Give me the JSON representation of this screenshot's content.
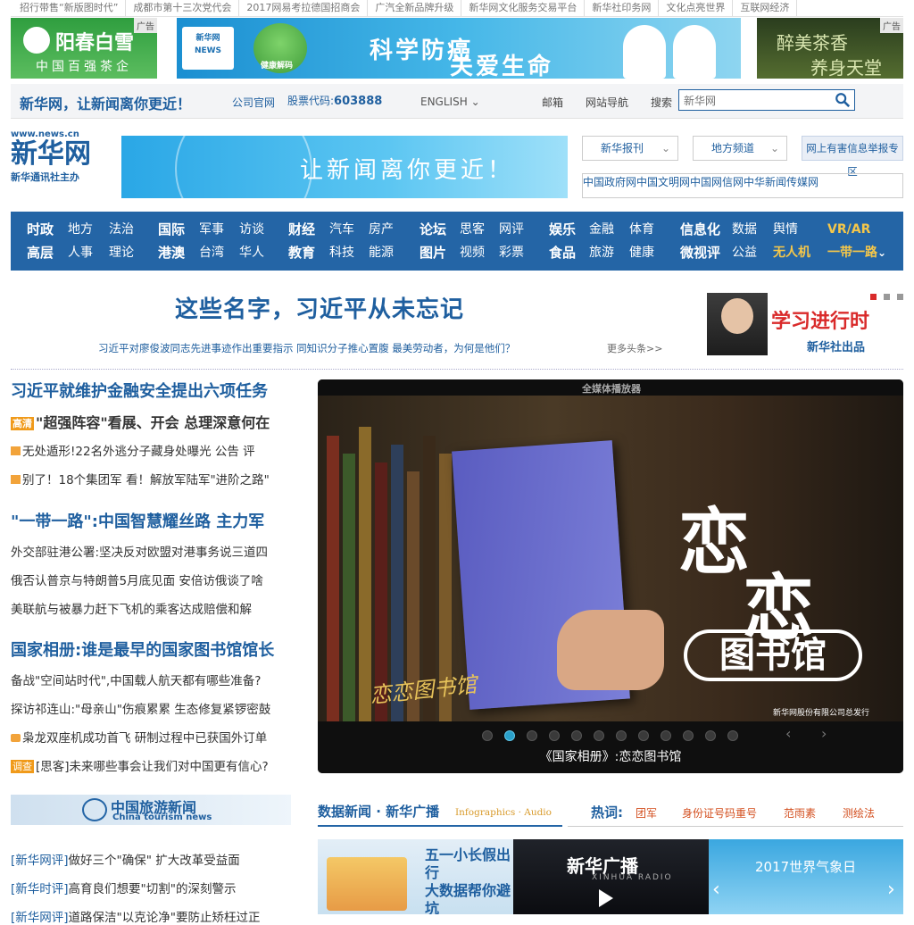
{
  "top_links": [
    "招行带售“新版图时代”",
    "成都市第十三次党代会",
    "2017网易考拉德国招商会",
    "广汽全新品牌升级",
    "新华网文化服务交易平台",
    "新华社印务网",
    "文化点亮世界",
    "互联网经济"
  ],
  "ads": {
    "tag": "广告",
    "ad1": {
      "title": "阳春白雪",
      "subtitle": "中国百强茶企"
    },
    "ad2": {
      "logo": "新华网 NEWS",
      "tree_label": "健康解码",
      "line1": "科学防癌",
      "line2": "关爱生命"
    },
    "ad3": {
      "line1": "醉美茶香",
      "line2": "养身天堂"
    }
  },
  "header": {
    "slogan": "新华网，让新闻离你更近！",
    "official_site": "公司官网",
    "stock_label": "股票代码:",
    "stock_code": "603888",
    "language": "ENGLISH",
    "mailbox": "邮箱",
    "site_nav": "网站导航",
    "search_label": "搜索",
    "search_placeholder": "新华网"
  },
  "logo": {
    "url": "www.news.cn",
    "name": "新华网",
    "tagline": "新华通讯社主办"
  },
  "banner": {
    "text": "让新闻离你更近！"
  },
  "header_buttons": {
    "newspapers": "新华报刊",
    "local": "地方频道",
    "report": "网上有害信息举报专区"
  },
  "partner_sites": [
    "中国政府网",
    "中国文明网",
    "中国网信网",
    "中华新闻传媒网"
  ],
  "nav": {
    "groups": [
      {
        "bold": "时政",
        "items": [
          "地方",
          "法治"
        ]
      },
      {
        "bold": "高层",
        "items": [
          "人事",
          "理论"
        ]
      },
      {
        "bold": "国际",
        "items": [
          "军事",
          "访谈"
        ]
      },
      {
        "bold": "港澳",
        "items": [
          "台湾",
          "华人"
        ]
      },
      {
        "bold": "财经",
        "items": [
          "汽车",
          "房产"
        ]
      },
      {
        "bold": "教育",
        "items": [
          "科技",
          "能源"
        ]
      },
      {
        "bold": "论坛",
        "items": [
          "思客",
          "网评"
        ]
      },
      {
        "bold": "图片",
        "items": [
          "视频",
          "彩票"
        ]
      },
      {
        "bold": "娱乐",
        "items": [
          "金融",
          "体育"
        ]
      },
      {
        "bold": "食品",
        "items": [
          "旅游",
          "健康"
        ]
      },
      {
        "bold": "信息化",
        "items": [
          "数据",
          "舆情"
        ]
      },
      {
        "bold": "微视评",
        "items": [
          "公益",
          "无人机"
        ]
      }
    ],
    "vr": "VR/AR",
    "belt": "一带一路"
  },
  "headline": {
    "title": "这些名字，习近平从未忘记",
    "subtitle": "习近平对廖俊波同志先进事迹作出重要指示 同知识分子推心置腹 最美劳动者，为何是他们？",
    "more": "更多头条>>"
  },
  "promo": {
    "title": "学习进行时",
    "publisher": "新华社出品"
  },
  "news_left": {
    "h1": "习近平就维护金融安全提出六项任务",
    "h2_tag": "高清",
    "h2": "\"超强阵容\"看展、开会 总理深意何在",
    "i1": "无处遁形!22名外逃分子藏身处曝光 公告 评",
    "i2": "别了！18个集团军 看！解放军陆军\"进阶之路\"",
    "h3": "\"一带一路\":中国智慧耀丝路 主力军",
    "i3": "外交部驻港公署:坚决反对欧盟对港事务说三道四",
    "i4": "俄否认普京与特朗普5月底见面 安倍访俄谈了啥",
    "i5": "美联航与被暴力赶下飞机的乘客达成赔偿和解",
    "h4": "国家相册:谁是最早的国家图书馆馆长",
    "i6": "备战\"空间站时代\",中国载人航天都有哪些准备?",
    "i7": "探访祁连山:\"母亲山\"伤痕累累 生态修复紧锣密鼓",
    "i8": "枭龙双座机成功首飞 研制过程中已获国外订单",
    "i9_tag": "调查",
    "i9": "[思客]未来哪些事会让我们对中国更有信心?"
  },
  "player": {
    "header": "全媒体播放器",
    "title_chars": [
      "恋",
      "恋"
    ],
    "subtitle": "图书馆",
    "calligraphy": "恋恋图书馆",
    "publisher_note": "新华网股份有限公司总发行",
    "caption": "《国家相册》:恋恋图书馆",
    "dots": 12,
    "active_dot": 1
  },
  "tourism": {
    "title": "中国旅游新闻",
    "subtitle": "China tourism news"
  },
  "commentary": [
    {
      "tag": "[新华网评]",
      "text": "做好三个\"确保\" 扩大改革受益面"
    },
    {
      "tag": "[新华时评]",
      "text": "高育良们想要\"切割\"的深刻警示"
    },
    {
      "tag": "[新华网评]",
      "text": "道路保洁\"以克论净\"要防止矫枉过正"
    }
  ],
  "data_news": {
    "title": "数据新闻 · 新华广播",
    "subtitle": "Infographics · Audio"
  },
  "hot": {
    "label": "热词:",
    "words": [
      "团军",
      "身份证号码重号",
      "范雨素",
      "测绘法"
    ]
  },
  "thumbs": [
    {
      "title_line1": "五一小长假出行",
      "title_line2": "大数据帮你避坑"
    },
    {
      "title": "新华广播",
      "sub": "XINHUA RADIO"
    },
    {
      "title": "2017世界气象日"
    }
  ],
  "colors": {
    "brand_blue": "#2465a6",
    "link_blue": "#1f5f9f",
    "accent_orange": "#f5c74a",
    "red": "#d92a2a"
  }
}
